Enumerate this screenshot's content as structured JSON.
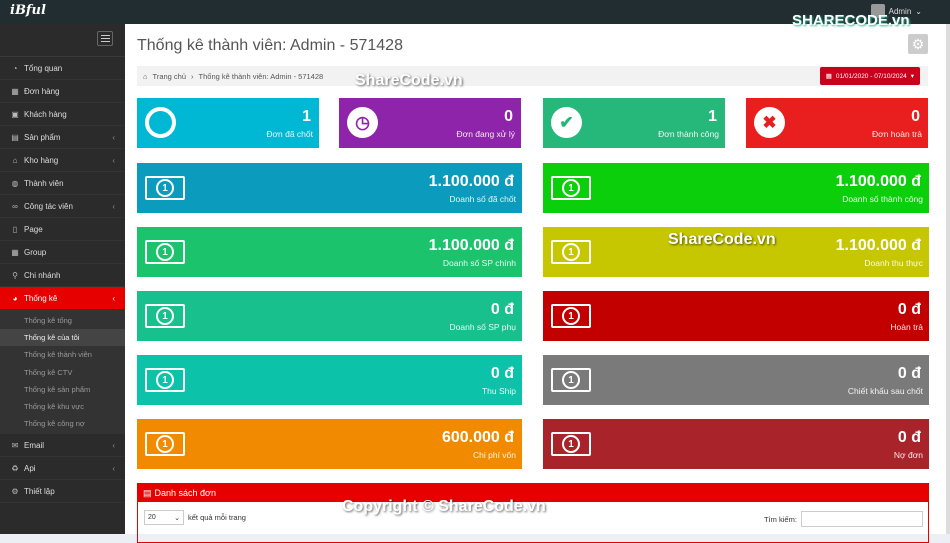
{
  "header": {
    "logo": "iBful",
    "user": "Admin"
  },
  "sidebar": {
    "items": [
      {
        "icon": "tachometer-icon",
        "glyph": "◔",
        "label": "Tổng quan",
        "chev": false
      },
      {
        "icon": "cart-icon",
        "glyph": "▦",
        "label": "Đơn hàng",
        "chev": false
      },
      {
        "icon": "contact-icon",
        "glyph": "▣",
        "label": "Khách hàng",
        "chev": false
      },
      {
        "icon": "cubes-icon",
        "glyph": "▤",
        "label": "Sản phẩm",
        "chev": true
      },
      {
        "icon": "home-icon",
        "glyph": "⌂",
        "label": "Kho hàng",
        "chev": true
      },
      {
        "icon": "users-icon",
        "glyph": "◍",
        "label": "Thành viên",
        "chev": false
      },
      {
        "icon": "handshake-icon",
        "glyph": "∞",
        "label": "Công tác viên",
        "chev": true
      },
      {
        "icon": "page-icon",
        "glyph": "▯",
        "label": "Page",
        "chev": false
      },
      {
        "icon": "group-icon",
        "glyph": "▦",
        "label": "Group",
        "chev": false
      },
      {
        "icon": "location-icon",
        "glyph": "⚲",
        "label": "Chi nhánh",
        "chev": false
      },
      {
        "icon": "piechart-icon",
        "glyph": "◕",
        "label": "Thống kê",
        "chev": true,
        "active": true
      }
    ],
    "sub": [
      "Thống kê tổng",
      "Thống kê của tôi",
      "Thống kê thành viên",
      "Thống kê CTV",
      "Thống kê sản phẩm",
      "Thống kê khu vực",
      "Thống kê công nợ"
    ],
    "bottom": [
      {
        "icon": "email-icon",
        "glyph": "✉",
        "label": "Email",
        "chev": true
      },
      {
        "icon": "recycle-icon",
        "glyph": "♻",
        "label": "Api",
        "chev": true
      },
      {
        "icon": "gear-icon",
        "glyph": "⚙",
        "label": "Thiết lập",
        "chev": false
      }
    ]
  },
  "page": {
    "title": "Thống kê thành viên: Admin - 571428",
    "breadcrumb_home": "Trang chủ",
    "breadcrumb_current": "Thống kê thành viên: Admin - 571428",
    "date_range": "01/01/2020 - 07/10/2024"
  },
  "small_cards": [
    {
      "value": "1",
      "label": "Đơn đã chốt",
      "color": "#00b8d4",
      "icon": "circle-icon"
    },
    {
      "value": "0",
      "label": "Đơn đang xử lý",
      "color": "#8e24aa",
      "icon": "clock-icon"
    },
    {
      "value": "1",
      "label": "Đơn thành công",
      "color": "#26b77a",
      "icon": "check-icon"
    },
    {
      "value": "0",
      "label": "Đơn hoàn trả",
      "color": "#e91e1e",
      "icon": "times-icon"
    }
  ],
  "money_cards": [
    {
      "value": "1.100.000 đ",
      "label": "Doanh số đã chốt",
      "color": "#0a9bbd"
    },
    {
      "value": "1.100.000 đ",
      "label": "Doanh số thành công",
      "color": "#0ccf0c"
    },
    {
      "value": "1.100.000 đ",
      "label": "Doanh số SP chính",
      "color": "#1bc46c"
    },
    {
      "value": "1.100.000 đ",
      "label": "Doanh thu thực",
      "color": "#c6c700"
    },
    {
      "value": "0 đ",
      "label": "Doanh số SP phụ",
      "color": "#17c08c"
    },
    {
      "value": "0 đ",
      "label": "Hoàn trả",
      "color": "#c20000"
    },
    {
      "value": "0 đ",
      "label": "Thu Ship",
      "color": "#0cc2a8"
    },
    {
      "value": "0 đ",
      "label": "Chiết khấu sau chốt",
      "color": "#7a7a7a"
    },
    {
      "value": "600.000 đ",
      "label": "Chi phí vốn",
      "color": "#f28a00"
    },
    {
      "value": "0 đ",
      "label": "Nợ đơn",
      "color": "#a8242a"
    }
  ],
  "panel": {
    "title": "Danh sách đơn",
    "page_size": "20",
    "page_size_label": "kết quả mỗi trang",
    "search_label": "Tìm kiếm:"
  },
  "watermarks": {
    "brand": "SHARECODE.vn",
    "site": "ShareCode.vn",
    "copyright": "Copyright © ShareCode.vn"
  }
}
